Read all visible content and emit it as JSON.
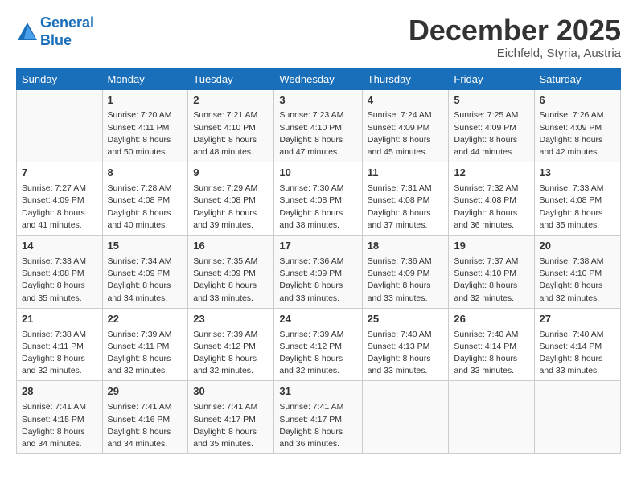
{
  "header": {
    "logo_line1": "General",
    "logo_line2": "Blue",
    "month": "December 2025",
    "location": "Eichfeld, Styria, Austria"
  },
  "days_of_week": [
    "Sunday",
    "Monday",
    "Tuesday",
    "Wednesday",
    "Thursday",
    "Friday",
    "Saturday"
  ],
  "weeks": [
    [
      {
        "day": "",
        "info": ""
      },
      {
        "day": "1",
        "info": "Sunrise: 7:20 AM\nSunset: 4:11 PM\nDaylight: 8 hours\nand 50 minutes."
      },
      {
        "day": "2",
        "info": "Sunrise: 7:21 AM\nSunset: 4:10 PM\nDaylight: 8 hours\nand 48 minutes."
      },
      {
        "day": "3",
        "info": "Sunrise: 7:23 AM\nSunset: 4:10 PM\nDaylight: 8 hours\nand 47 minutes."
      },
      {
        "day": "4",
        "info": "Sunrise: 7:24 AM\nSunset: 4:09 PM\nDaylight: 8 hours\nand 45 minutes."
      },
      {
        "day": "5",
        "info": "Sunrise: 7:25 AM\nSunset: 4:09 PM\nDaylight: 8 hours\nand 44 minutes."
      },
      {
        "day": "6",
        "info": "Sunrise: 7:26 AM\nSunset: 4:09 PM\nDaylight: 8 hours\nand 42 minutes."
      }
    ],
    [
      {
        "day": "7",
        "info": "Sunrise: 7:27 AM\nSunset: 4:09 PM\nDaylight: 8 hours\nand 41 minutes."
      },
      {
        "day": "8",
        "info": "Sunrise: 7:28 AM\nSunset: 4:08 PM\nDaylight: 8 hours\nand 40 minutes."
      },
      {
        "day": "9",
        "info": "Sunrise: 7:29 AM\nSunset: 4:08 PM\nDaylight: 8 hours\nand 39 minutes."
      },
      {
        "day": "10",
        "info": "Sunrise: 7:30 AM\nSunset: 4:08 PM\nDaylight: 8 hours\nand 38 minutes."
      },
      {
        "day": "11",
        "info": "Sunrise: 7:31 AM\nSunset: 4:08 PM\nDaylight: 8 hours\nand 37 minutes."
      },
      {
        "day": "12",
        "info": "Sunrise: 7:32 AM\nSunset: 4:08 PM\nDaylight: 8 hours\nand 36 minutes."
      },
      {
        "day": "13",
        "info": "Sunrise: 7:33 AM\nSunset: 4:08 PM\nDaylight: 8 hours\nand 35 minutes."
      }
    ],
    [
      {
        "day": "14",
        "info": "Sunrise: 7:33 AM\nSunset: 4:08 PM\nDaylight: 8 hours\nand 35 minutes."
      },
      {
        "day": "15",
        "info": "Sunrise: 7:34 AM\nSunset: 4:09 PM\nDaylight: 8 hours\nand 34 minutes."
      },
      {
        "day": "16",
        "info": "Sunrise: 7:35 AM\nSunset: 4:09 PM\nDaylight: 8 hours\nand 33 minutes."
      },
      {
        "day": "17",
        "info": "Sunrise: 7:36 AM\nSunset: 4:09 PM\nDaylight: 8 hours\nand 33 minutes."
      },
      {
        "day": "18",
        "info": "Sunrise: 7:36 AM\nSunset: 4:09 PM\nDaylight: 8 hours\nand 33 minutes."
      },
      {
        "day": "19",
        "info": "Sunrise: 7:37 AM\nSunset: 4:10 PM\nDaylight: 8 hours\nand 32 minutes."
      },
      {
        "day": "20",
        "info": "Sunrise: 7:38 AM\nSunset: 4:10 PM\nDaylight: 8 hours\nand 32 minutes."
      }
    ],
    [
      {
        "day": "21",
        "info": "Sunrise: 7:38 AM\nSunset: 4:11 PM\nDaylight: 8 hours\nand 32 minutes."
      },
      {
        "day": "22",
        "info": "Sunrise: 7:39 AM\nSunset: 4:11 PM\nDaylight: 8 hours\nand 32 minutes."
      },
      {
        "day": "23",
        "info": "Sunrise: 7:39 AM\nSunset: 4:12 PM\nDaylight: 8 hours\nand 32 minutes."
      },
      {
        "day": "24",
        "info": "Sunrise: 7:39 AM\nSunset: 4:12 PM\nDaylight: 8 hours\nand 32 minutes."
      },
      {
        "day": "25",
        "info": "Sunrise: 7:40 AM\nSunset: 4:13 PM\nDaylight: 8 hours\nand 33 minutes."
      },
      {
        "day": "26",
        "info": "Sunrise: 7:40 AM\nSunset: 4:14 PM\nDaylight: 8 hours\nand 33 minutes."
      },
      {
        "day": "27",
        "info": "Sunrise: 7:40 AM\nSunset: 4:14 PM\nDaylight: 8 hours\nand 33 minutes."
      }
    ],
    [
      {
        "day": "28",
        "info": "Sunrise: 7:41 AM\nSunset: 4:15 PM\nDaylight: 8 hours\nand 34 minutes."
      },
      {
        "day": "29",
        "info": "Sunrise: 7:41 AM\nSunset: 4:16 PM\nDaylight: 8 hours\nand 34 minutes."
      },
      {
        "day": "30",
        "info": "Sunrise: 7:41 AM\nSunset: 4:17 PM\nDaylight: 8 hours\nand 35 minutes."
      },
      {
        "day": "31",
        "info": "Sunrise: 7:41 AM\nSunset: 4:17 PM\nDaylight: 8 hours\nand 36 minutes."
      },
      {
        "day": "",
        "info": ""
      },
      {
        "day": "",
        "info": ""
      },
      {
        "day": "",
        "info": ""
      }
    ]
  ]
}
